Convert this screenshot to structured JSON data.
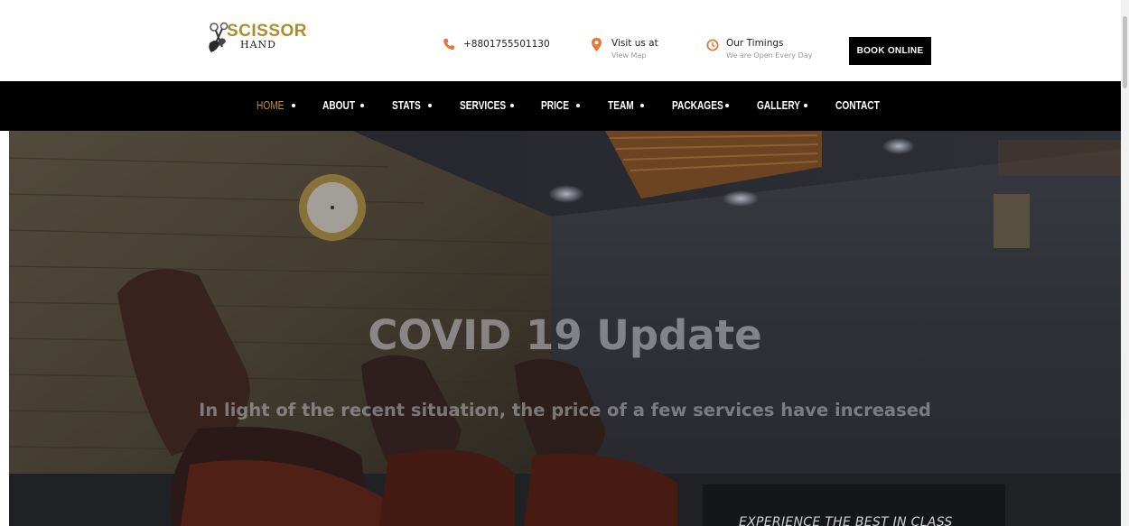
{
  "header": {
    "logo_text": "SCISSOR",
    "logo_sub": "HAND",
    "phone": "+8801755501130",
    "visit_title": "Visit us at",
    "visit_sub": "View Map",
    "timings_title": "Our Timings",
    "timings_sub": "We are Open Every Day",
    "book_label": "BOOK ONLINE",
    "accent_color": "#e07b39"
  },
  "nav": {
    "items": [
      {
        "label": "HOME",
        "active": true
      },
      {
        "label": "ABOUT"
      },
      {
        "label": "STATS"
      },
      {
        "label": "SERVICES"
      },
      {
        "label": "PRICE"
      },
      {
        "label": "TEAM"
      },
      {
        "label": "PACKAGES"
      },
      {
        "label": "GALLERY"
      },
      {
        "label": "CONTACT"
      }
    ]
  },
  "hero": {
    "title": "COVID 19 Update",
    "subtitle": "In light of the recent situation, the price of a few services have increased",
    "overlay_text": "EXPERIENCE THE BEST IN CLASS"
  }
}
